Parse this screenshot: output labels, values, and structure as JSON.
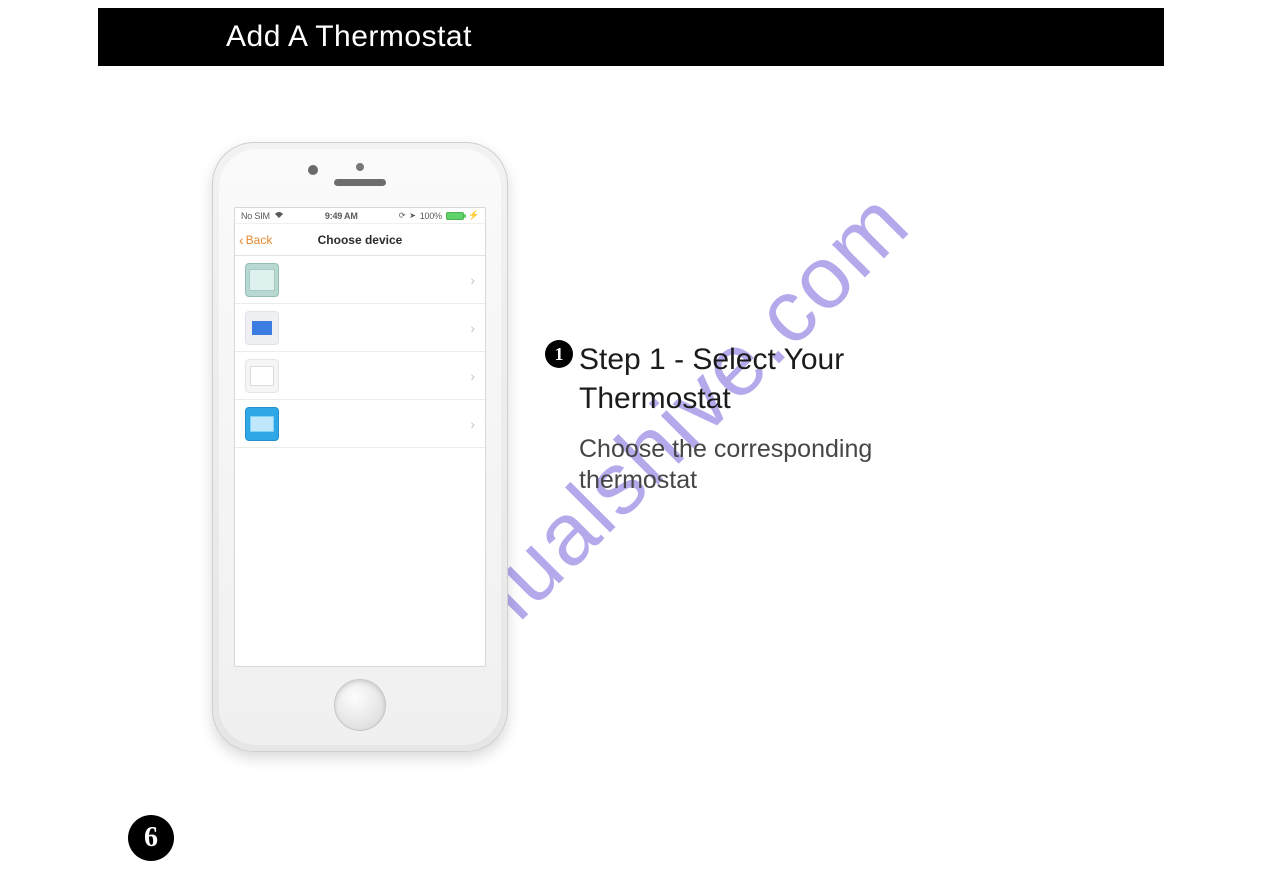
{
  "header": {
    "title": "Add A Thermostat"
  },
  "watermark": "manualshive.com",
  "phone": {
    "status": {
      "carrier": "No SIM",
      "wifi": "▴",
      "time": "9:49 AM",
      "battery_pct": "100%"
    },
    "nav": {
      "back_label": "Back",
      "title": "Choose device"
    },
    "devices": [
      {
        "id": "thermo-1"
      },
      {
        "id": "thermo-2"
      },
      {
        "id": "thermo-3"
      },
      {
        "id": "thermo-4"
      }
    ]
  },
  "instruction": {
    "step_number": "1",
    "title_line1": "Step 1 - Select  Your",
    "title_line2": "Thermostat",
    "description": "Choose the corresponding thermostat"
  },
  "page_number": "6"
}
